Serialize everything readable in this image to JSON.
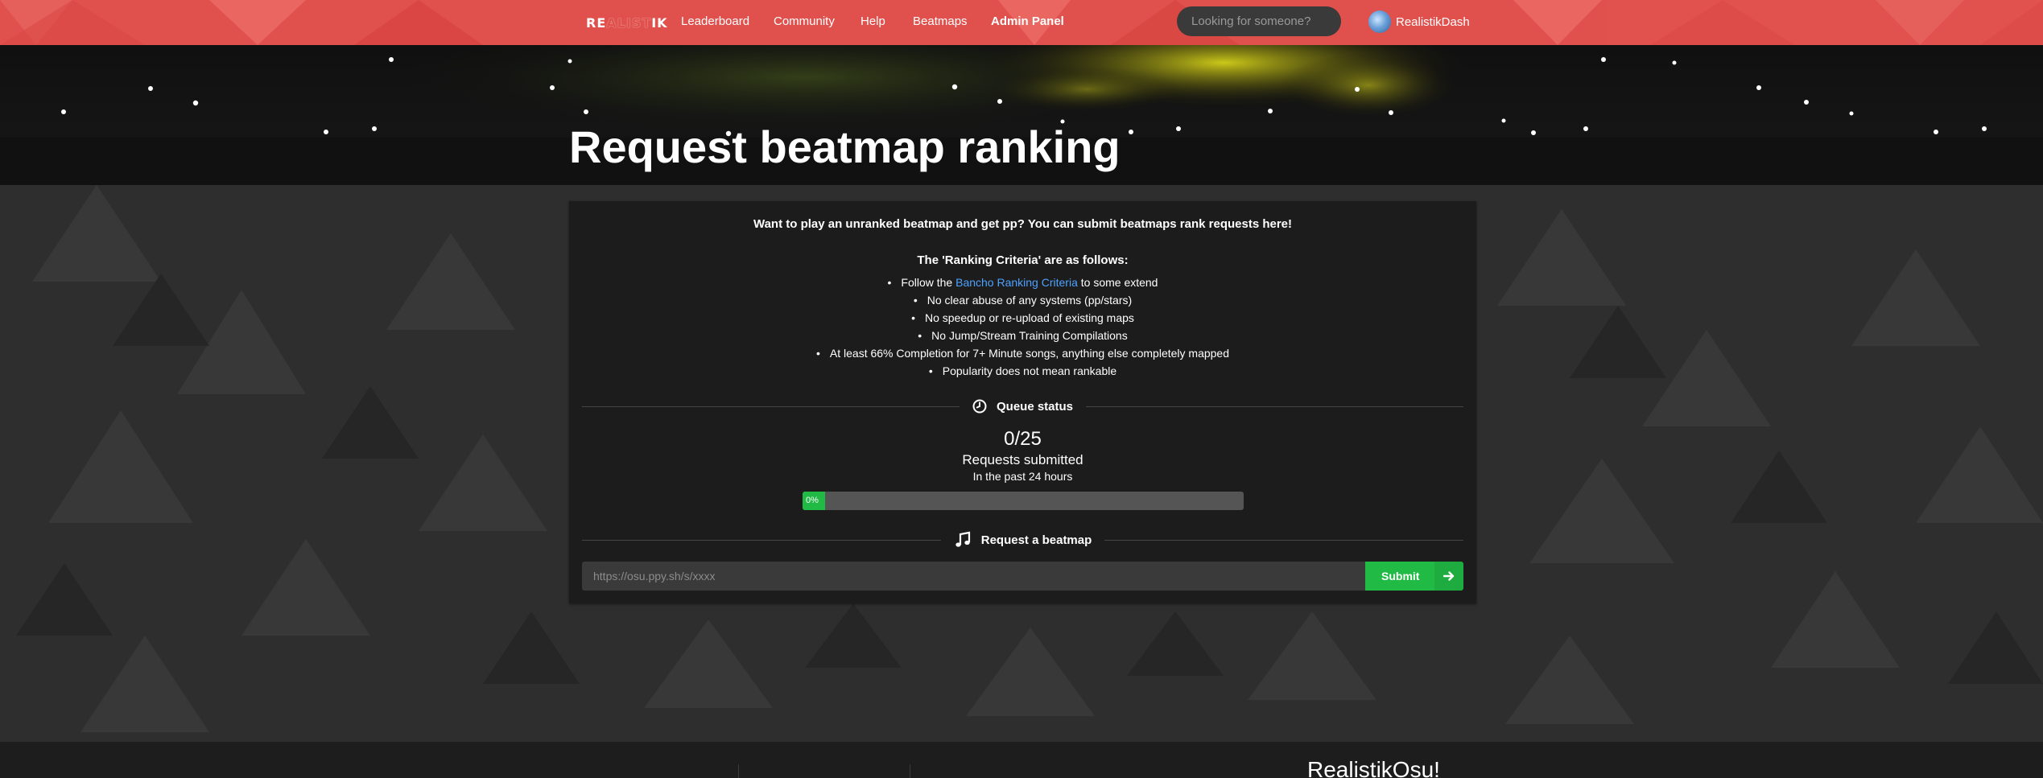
{
  "nav": {
    "logo": {
      "part1": "RE",
      "part2": "ALIST",
      "part3": "IK"
    },
    "links": [
      {
        "label": "Leaderboard"
      },
      {
        "label": "Community"
      },
      {
        "label": "Help"
      },
      {
        "label": "Beatmaps"
      },
      {
        "label": "Admin Panel"
      }
    ],
    "search_placeholder": "Looking for someone?",
    "username": "RealistikDash"
  },
  "header": {
    "title": "Request beatmap ranking"
  },
  "card": {
    "intro": "Want to play an unranked beatmap and get pp? You can submit beatmaps rank requests here!",
    "criteria_title": "The 'Ranking Criteria' are as follows:",
    "criteria_first": {
      "prefix": "Follow the ",
      "link": "Bancho Ranking Criteria",
      "suffix": " to some extend"
    },
    "criteria": [
      "No clear abuse of any systems (pp/stars)",
      "No speedup or re-upload of existing maps",
      "No Jump/Stream Training Compilations",
      "At least 66% Completion for 7+ Minute songs, anything else completely mapped",
      "Popularity does not mean rankable"
    ],
    "queue": {
      "heading": "Queue status",
      "count": "0/25",
      "label": "Requests submitted",
      "sub": "In the past 24 hours",
      "progress_label": "0%",
      "progress_fraction": 0
    },
    "request": {
      "heading": "Request a beatmap",
      "placeholder": "https://osu.ppy.sh/s/xxxx",
      "submit_label": "Submit"
    }
  },
  "footer": {
    "brand": "RealistikOsu!"
  },
  "colors": {
    "nav": "#e0514d",
    "accent_green": "#21ba45",
    "link": "#4ea1ff",
    "card": "#1c1c1c"
  }
}
